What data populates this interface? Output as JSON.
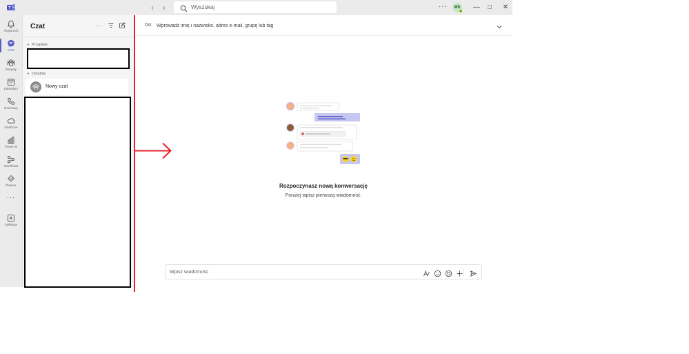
{
  "titlebar": {
    "search_placeholder": "Wyszukaj",
    "more_label": "···",
    "user_initials": "MS",
    "minimize_glyph": "—",
    "maximize_glyph": "□",
    "close_glyph": "✕",
    "back_glyph": "‹",
    "forward_glyph": "›"
  },
  "rail": {
    "items": [
      {
        "label": "Aktywność",
        "icon": "bell-icon"
      },
      {
        "label": "Czat",
        "icon": "chat-icon",
        "active": true
      },
      {
        "label": "Zespoły",
        "icon": "teams-icon"
      },
      {
        "label": "Kalendarz",
        "icon": "calendar-icon"
      },
      {
        "label": "Rozmowy",
        "icon": "phone-icon"
      },
      {
        "label": "OneDrive",
        "icon": "cloud-icon"
      },
      {
        "label": "Power BI",
        "icon": "powerbi-icon"
      },
      {
        "label": "Workflows",
        "icon": "workflows-icon"
      },
      {
        "label": "Planner",
        "icon": "planner-icon"
      }
    ],
    "more_label": "···",
    "apps_label": "Aplikacje"
  },
  "chatlist": {
    "title": "Czat",
    "more_label": "···",
    "pinned_label": "Przypięte",
    "recent_label": "Ostatnie",
    "new_chat_label": "Nowy czat"
  },
  "main": {
    "to_label": "Do:",
    "to_placeholder": "Wprowadź imię i nazwisko, adres e-mail, grupę lub tag",
    "empty_title": "Rozpoczynasz nową konwersację",
    "empty_subtitle": "Poniżej wpisz pierwszą wiadomość.",
    "compose_placeholder": "Wpisz wiadomość"
  },
  "colors": {
    "accent": "#5b5fc7",
    "annotation_red": "#e8202a",
    "redaction": "#000000"
  }
}
